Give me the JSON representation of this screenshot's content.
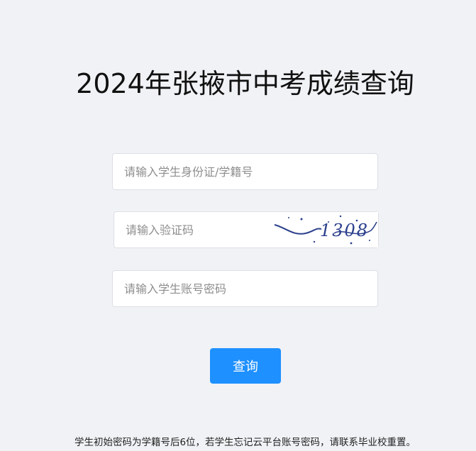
{
  "page": {
    "title": "2024年张掖市中考成绩查询"
  },
  "form": {
    "id_placeholder": "请输入学生身份证/学籍号",
    "captcha_placeholder": "请输入验证码",
    "password_placeholder": "请输入学生账号密码",
    "captcha_text": "1308",
    "submit_label": "查询"
  },
  "notice": {
    "text": "学生初始密码为学籍号后6位，若学生忘记云平台账号密码，请联系毕业校重置。"
  },
  "colors": {
    "background": "#f0f2f5",
    "button": "#1e90ff",
    "captcha_ink": "#2b3f8c"
  }
}
